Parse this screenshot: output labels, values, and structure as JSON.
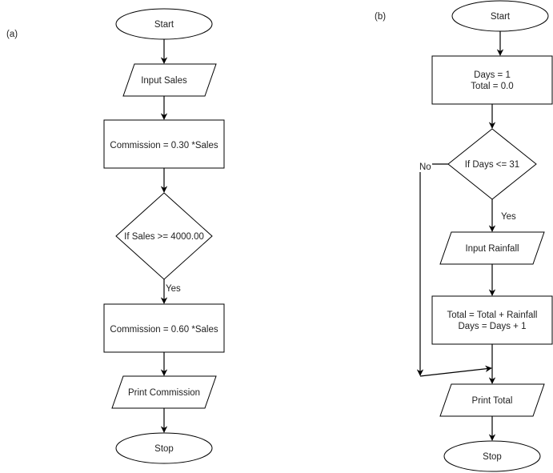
{
  "diagrams": {
    "a": {
      "label": "(a)",
      "nodes": {
        "start": "Start",
        "input": "Input Sales",
        "comm1": "Commission = 0.30 *Sales",
        "decision": "If Sales >= 4000.00",
        "comm2": "Commission = 0.60 *Sales",
        "print": "Print Commission",
        "stop": "Stop"
      },
      "edge_labels": {
        "yes": "Yes"
      }
    },
    "b": {
      "label": "(b)",
      "nodes": {
        "start": "Start",
        "init_line1": "Days = 1",
        "init_line2": "Total = 0.0",
        "decision": "If Days <= 31",
        "input": "Input Rainfall",
        "update_line1": "Total = Total + Rainfall",
        "update_line2": "Days = Days + 1",
        "print": "Print Total",
        "stop": "Stop"
      },
      "edge_labels": {
        "yes": "Yes",
        "no": "No"
      }
    }
  }
}
